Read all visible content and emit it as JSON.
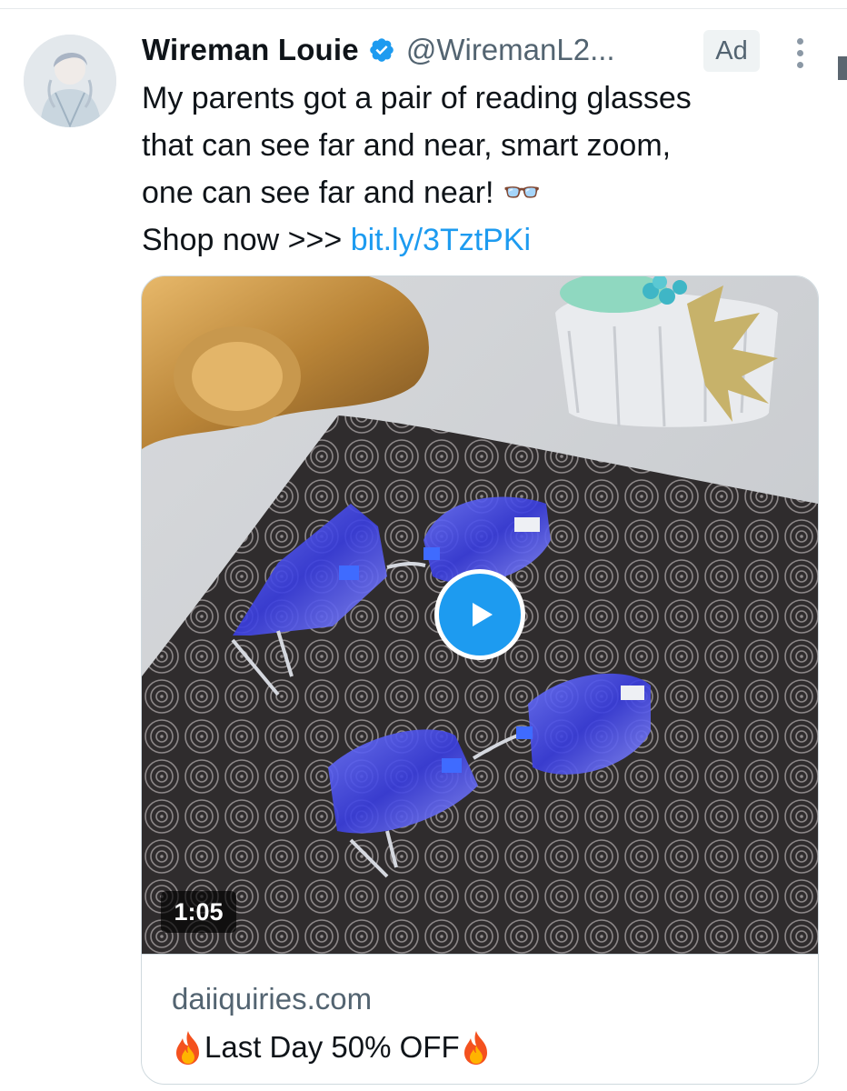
{
  "tweet": {
    "author": {
      "display_name": "Wireman Louie",
      "handle": "@WiremanL2...",
      "verified": true
    },
    "badge": "Ad",
    "text_lines": [
      "My parents got a pair of reading glasses",
      "that can see far and near, smart zoom,",
      "one can see far and near! 👓"
    ],
    "cta_prefix": "Shop now >>> ",
    "cta_link": "bit.ly/3TztPKi"
  },
  "card": {
    "video_duration": "1:05",
    "domain": "daiiquiries.com",
    "title": "Last Day 50% OFF",
    "title_emoji_icon": "fire-icon"
  },
  "colors": {
    "link": "#1d9bf0",
    "secondary_text": "#536471",
    "play_button": "#1d9bf0",
    "verified_badge": "#1d9bf0"
  }
}
